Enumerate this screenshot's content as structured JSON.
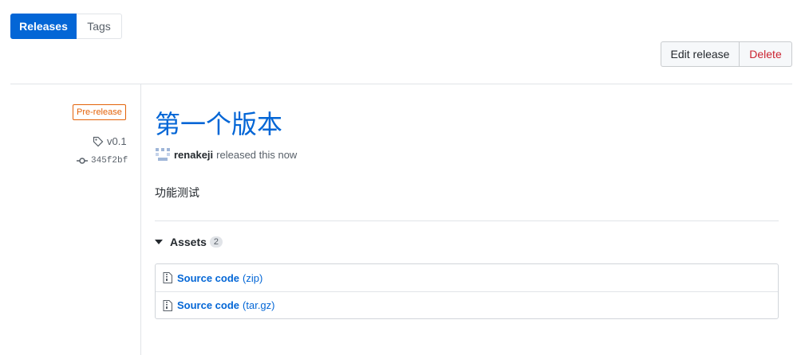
{
  "tabs": [
    {
      "label": "Releases",
      "active": true
    },
    {
      "label": "Tags",
      "active": false
    }
  ],
  "actions": {
    "edit_label": "Edit release",
    "delete_label": "Delete"
  },
  "sidebar": {
    "badge": "Pre-release",
    "tag": "v0.1",
    "commit": "345f2bf"
  },
  "release": {
    "title": "第一个版本",
    "author": "renakeji",
    "released_text": "released this now",
    "body": "功能测试"
  },
  "assets": {
    "label": "Assets",
    "count": "2",
    "items": [
      {
        "name": "Source code",
        "ext": "(zip)"
      },
      {
        "name": "Source code",
        "ext": "(tar.gz)"
      }
    ]
  },
  "colors": {
    "accent": "#0366d6",
    "danger": "#cb2431",
    "prerelease": "#e36209"
  }
}
